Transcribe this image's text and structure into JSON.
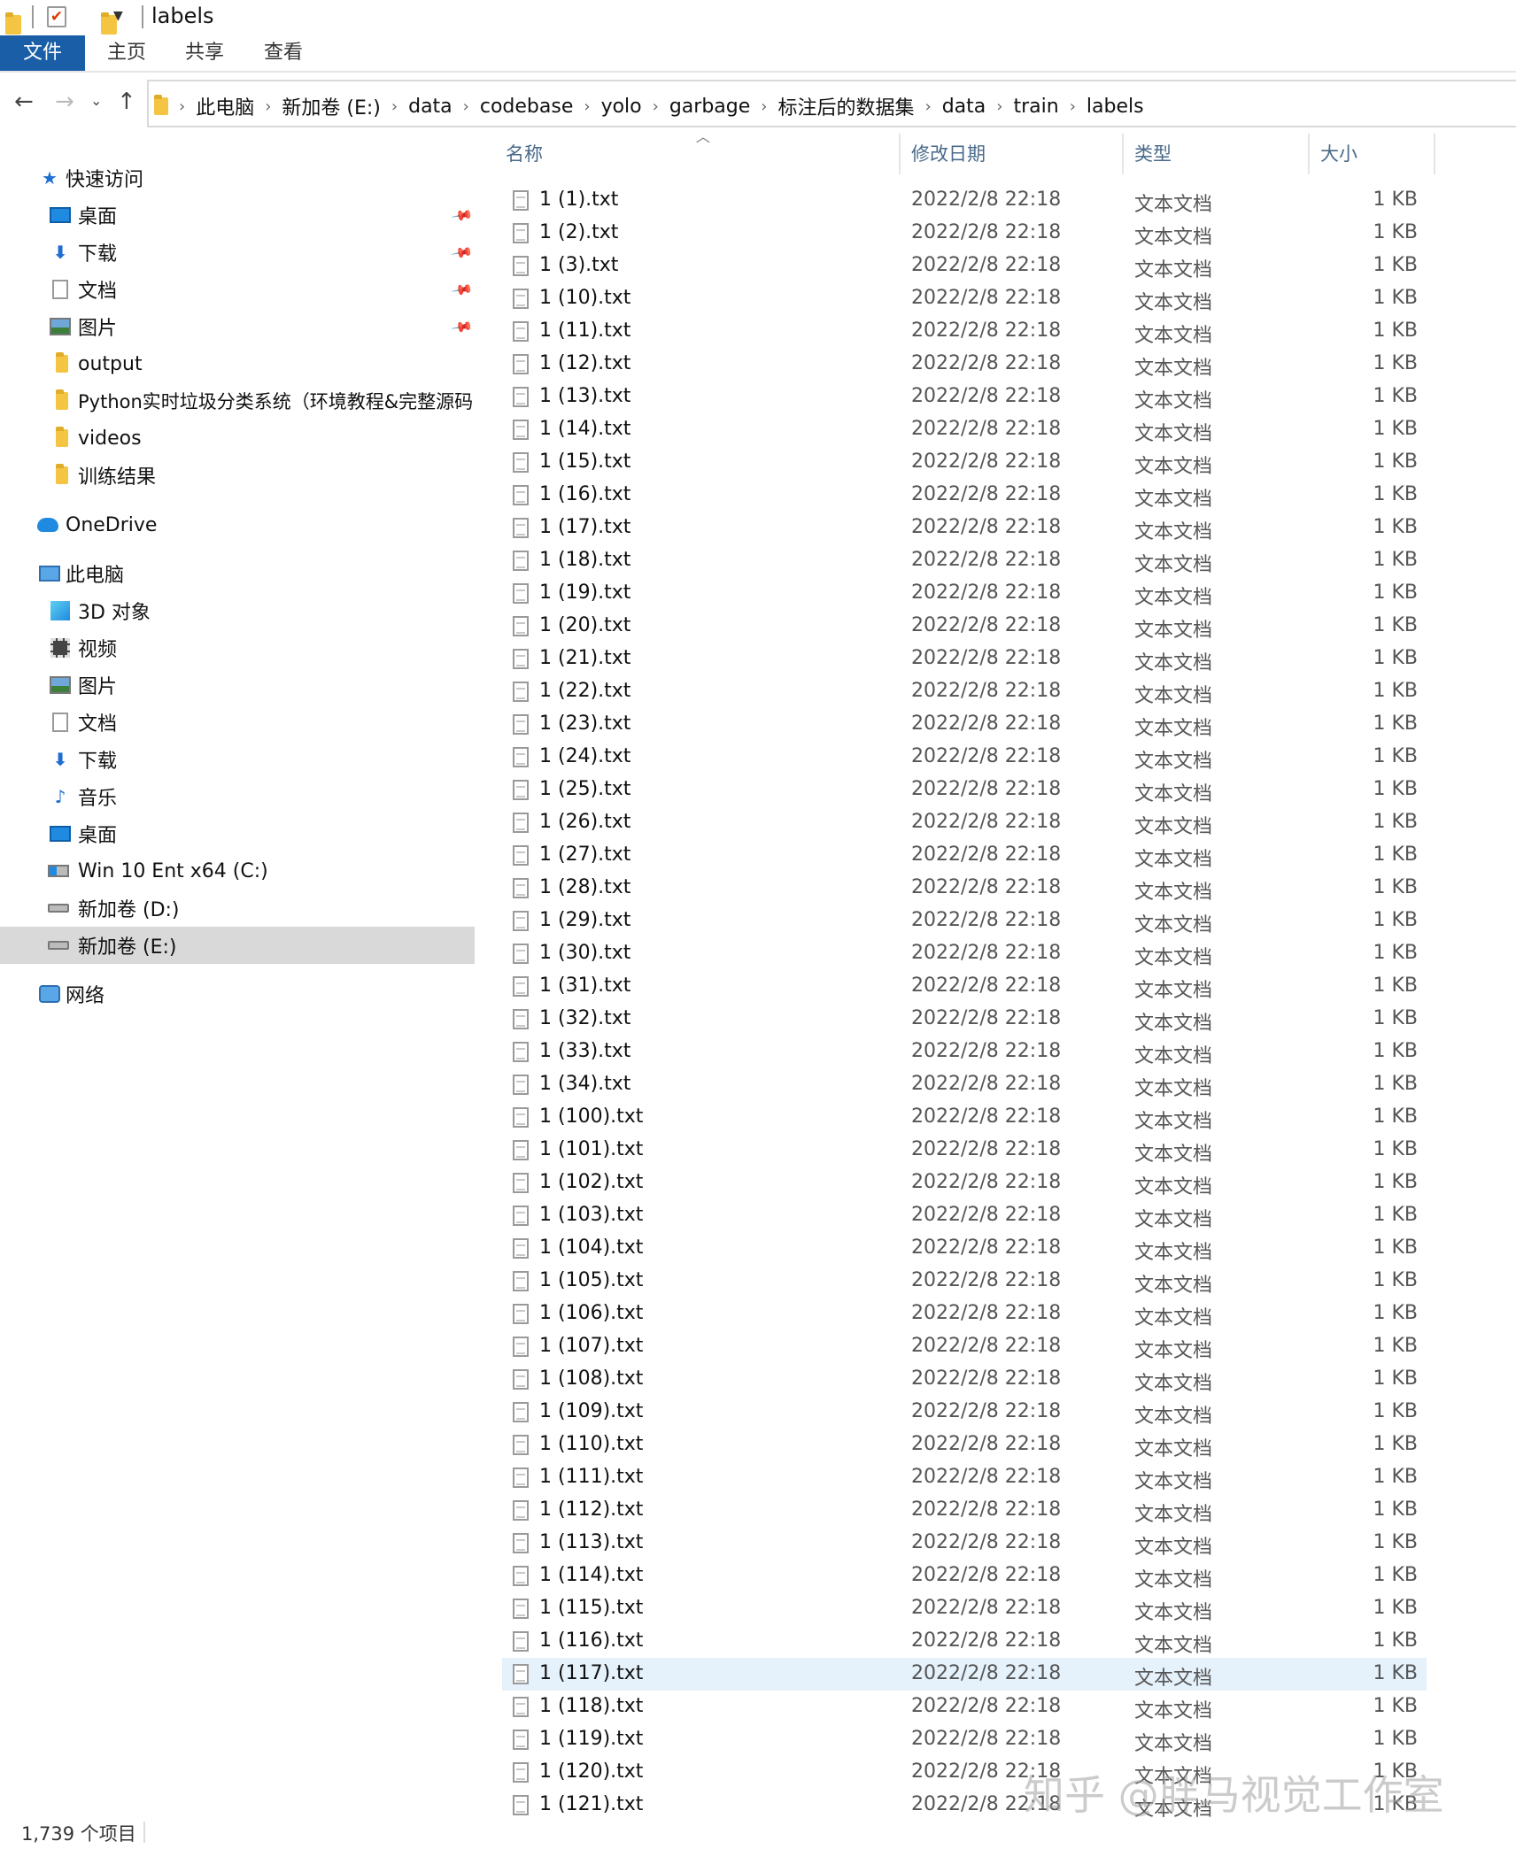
{
  "window": {
    "title": "labels"
  },
  "ribbon": {
    "tabs": [
      "文件",
      "主页",
      "共享",
      "查看"
    ]
  },
  "address": {
    "crumbs": [
      "此电脑",
      "新加卷 (E:)",
      "data",
      "codebase",
      "yolo",
      "garbage",
      "标注后的数据集",
      "data",
      "train",
      "labels"
    ]
  },
  "sidebar": {
    "quick_access": "快速访问",
    "quick_items": [
      "桌面",
      "下载",
      "文档",
      "图片",
      "output",
      "Python实时垃圾分类系统（环境教程&完整源码",
      "videos",
      "训练结果"
    ],
    "onedrive": "OneDrive",
    "this_pc": "此电脑",
    "pc_items": [
      "3D 对象",
      "视频",
      "图片",
      "文档",
      "下载",
      "音乐",
      "桌面",
      "Win 10 Ent x64 (C:)",
      "新加卷 (D:)",
      "新加卷 (E:)"
    ],
    "network": "网络"
  },
  "columns": {
    "name": "名称",
    "date": "修改日期",
    "type": "类型",
    "size": "大小"
  },
  "files": [
    {
      "name": "1 (1).txt",
      "date": "2022/2/8 22:18",
      "type": "文本文档",
      "size": "1 KB"
    },
    {
      "name": "1 (2).txt",
      "date": "2022/2/8 22:18",
      "type": "文本文档",
      "size": "1 KB"
    },
    {
      "name": "1 (3).txt",
      "date": "2022/2/8 22:18",
      "type": "文本文档",
      "size": "1 KB"
    },
    {
      "name": "1 (10).txt",
      "date": "2022/2/8 22:18",
      "type": "文本文档",
      "size": "1 KB"
    },
    {
      "name": "1 (11).txt",
      "date": "2022/2/8 22:18",
      "type": "文本文档",
      "size": "1 KB"
    },
    {
      "name": "1 (12).txt",
      "date": "2022/2/8 22:18",
      "type": "文本文档",
      "size": "1 KB"
    },
    {
      "name": "1 (13).txt",
      "date": "2022/2/8 22:18",
      "type": "文本文档",
      "size": "1 KB"
    },
    {
      "name": "1 (14).txt",
      "date": "2022/2/8 22:18",
      "type": "文本文档",
      "size": "1 KB"
    },
    {
      "name": "1 (15).txt",
      "date": "2022/2/8 22:18",
      "type": "文本文档",
      "size": "1 KB"
    },
    {
      "name": "1 (16).txt",
      "date": "2022/2/8 22:18",
      "type": "文本文档",
      "size": "1 KB"
    },
    {
      "name": "1 (17).txt",
      "date": "2022/2/8 22:18",
      "type": "文本文档",
      "size": "1 KB"
    },
    {
      "name": "1 (18).txt",
      "date": "2022/2/8 22:18",
      "type": "文本文档",
      "size": "1 KB"
    },
    {
      "name": "1 (19).txt",
      "date": "2022/2/8 22:18",
      "type": "文本文档",
      "size": "1 KB"
    },
    {
      "name": "1 (20).txt",
      "date": "2022/2/8 22:18",
      "type": "文本文档",
      "size": "1 KB"
    },
    {
      "name": "1 (21).txt",
      "date": "2022/2/8 22:18",
      "type": "文本文档",
      "size": "1 KB"
    },
    {
      "name": "1 (22).txt",
      "date": "2022/2/8 22:18",
      "type": "文本文档",
      "size": "1 KB"
    },
    {
      "name": "1 (23).txt",
      "date": "2022/2/8 22:18",
      "type": "文本文档",
      "size": "1 KB"
    },
    {
      "name": "1 (24).txt",
      "date": "2022/2/8 22:18",
      "type": "文本文档",
      "size": "1 KB"
    },
    {
      "name": "1 (25).txt",
      "date": "2022/2/8 22:18",
      "type": "文本文档",
      "size": "1 KB"
    },
    {
      "name": "1 (26).txt",
      "date": "2022/2/8 22:18",
      "type": "文本文档",
      "size": "1 KB"
    },
    {
      "name": "1 (27).txt",
      "date": "2022/2/8 22:18",
      "type": "文本文档",
      "size": "1 KB"
    },
    {
      "name": "1 (28).txt",
      "date": "2022/2/8 22:18",
      "type": "文本文档",
      "size": "1 KB"
    },
    {
      "name": "1 (29).txt",
      "date": "2022/2/8 22:18",
      "type": "文本文档",
      "size": "1 KB"
    },
    {
      "name": "1 (30).txt",
      "date": "2022/2/8 22:18",
      "type": "文本文档",
      "size": "1 KB"
    },
    {
      "name": "1 (31).txt",
      "date": "2022/2/8 22:18",
      "type": "文本文档",
      "size": "1 KB"
    },
    {
      "name": "1 (32).txt",
      "date": "2022/2/8 22:18",
      "type": "文本文档",
      "size": "1 KB"
    },
    {
      "name": "1 (33).txt",
      "date": "2022/2/8 22:18",
      "type": "文本文档",
      "size": "1 KB"
    },
    {
      "name": "1 (34).txt",
      "date": "2022/2/8 22:18",
      "type": "文本文档",
      "size": "1 KB"
    },
    {
      "name": "1 (100).txt",
      "date": "2022/2/8 22:18",
      "type": "文本文档",
      "size": "1 KB"
    },
    {
      "name": "1 (101).txt",
      "date": "2022/2/8 22:18",
      "type": "文本文档",
      "size": "1 KB"
    },
    {
      "name": "1 (102).txt",
      "date": "2022/2/8 22:18",
      "type": "文本文档",
      "size": "1 KB"
    },
    {
      "name": "1 (103).txt",
      "date": "2022/2/8 22:18",
      "type": "文本文档",
      "size": "1 KB"
    },
    {
      "name": "1 (104).txt",
      "date": "2022/2/8 22:18",
      "type": "文本文档",
      "size": "1 KB"
    },
    {
      "name": "1 (105).txt",
      "date": "2022/2/8 22:18",
      "type": "文本文档",
      "size": "1 KB"
    },
    {
      "name": "1 (106).txt",
      "date": "2022/2/8 22:18",
      "type": "文本文档",
      "size": "1 KB"
    },
    {
      "name": "1 (107).txt",
      "date": "2022/2/8 22:18",
      "type": "文本文档",
      "size": "1 KB"
    },
    {
      "name": "1 (108).txt",
      "date": "2022/2/8 22:18",
      "type": "文本文档",
      "size": "1 KB"
    },
    {
      "name": "1 (109).txt",
      "date": "2022/2/8 22:18",
      "type": "文本文档",
      "size": "1 KB"
    },
    {
      "name": "1 (110).txt",
      "date": "2022/2/8 22:18",
      "type": "文本文档",
      "size": "1 KB"
    },
    {
      "name": "1 (111).txt",
      "date": "2022/2/8 22:18",
      "type": "文本文档",
      "size": "1 KB"
    },
    {
      "name": "1 (112).txt",
      "date": "2022/2/8 22:18",
      "type": "文本文档",
      "size": "1 KB"
    },
    {
      "name": "1 (113).txt",
      "date": "2022/2/8 22:18",
      "type": "文本文档",
      "size": "1 KB"
    },
    {
      "name": "1 (114).txt",
      "date": "2022/2/8 22:18",
      "type": "文本文档",
      "size": "1 KB"
    },
    {
      "name": "1 (115).txt",
      "date": "2022/2/8 22:18",
      "type": "文本文档",
      "size": "1 KB"
    },
    {
      "name": "1 (116).txt",
      "date": "2022/2/8 22:18",
      "type": "文本文档",
      "size": "1 KB"
    },
    {
      "name": "1 (117).txt",
      "date": "2022/2/8 22:18",
      "type": "文本文档",
      "size": "1 KB"
    },
    {
      "name": "1 (118).txt",
      "date": "2022/2/8 22:18",
      "type": "文本文档",
      "size": "1 KB"
    },
    {
      "name": "1 (119).txt",
      "date": "2022/2/8 22:18",
      "type": "文本文档",
      "size": "1 KB"
    },
    {
      "name": "1 (120).txt",
      "date": "2022/2/8 22:18",
      "type": "文本文档",
      "size": "1 KB"
    },
    {
      "name": "1 (121).txt",
      "date": "2022/2/8 22:18",
      "type": "文本文档",
      "size": "1 KB"
    }
  ],
  "status": {
    "count": "1,739 个项目"
  },
  "watermark": "知乎 @胖马视觉工作室",
  "colors": {
    "ribbon_active": "#1a5ea8",
    "selected_nav": "#d9d9d9",
    "hover_row": "#e5f1fb",
    "folder": "#f4c542"
  }
}
